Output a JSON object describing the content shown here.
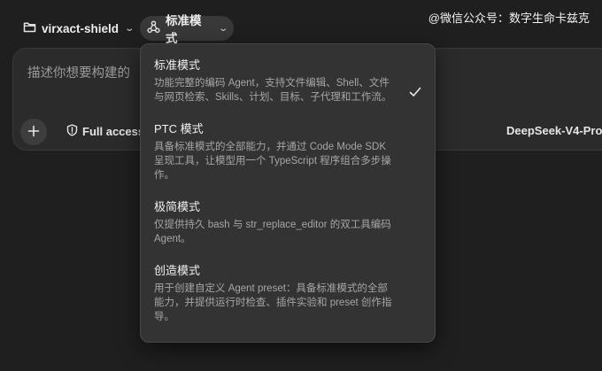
{
  "topbar": {
    "project_name": "virxact-shield",
    "mode_label": "标准模式",
    "watermark": "@微信公众号：数字生命卡兹克"
  },
  "composer": {
    "placeholder": "描述你想要构建的",
    "access_label": "Full access",
    "model_label": "DeepSeek-V4-Pro"
  },
  "menu": {
    "items": [
      {
        "title": "标准模式",
        "desc": "功能完整的编码 Agent，支持文件编辑、Shell、文件与网页检索、Skills、计划、目标、子代理和工作流。",
        "selected": true
      },
      {
        "title": "PTC 模式",
        "desc": "具备标准模式的全部能力，并通过 Code Mode SDK 呈现工具，让模型用一个 TypeScript 程序组合多步操作。",
        "selected": false
      },
      {
        "title": "极简模式",
        "desc": "仅提供持久 bash 与 str_replace_editor 的双工具编码 Agent。",
        "selected": false
      },
      {
        "title": "创造模式",
        "desc": "用于创建自定义 Agent preset：具备标准模式的全部能力，并提供运行时检查、插件实验和 preset 创作指导。",
        "selected": false
      }
    ]
  },
  "icons": {
    "folder": "folder-icon",
    "mode": "mode-nodes-icon",
    "chevron": "chevron-down-icon",
    "plus": "plus-icon",
    "shield": "shield-icon",
    "check": "check-icon"
  }
}
